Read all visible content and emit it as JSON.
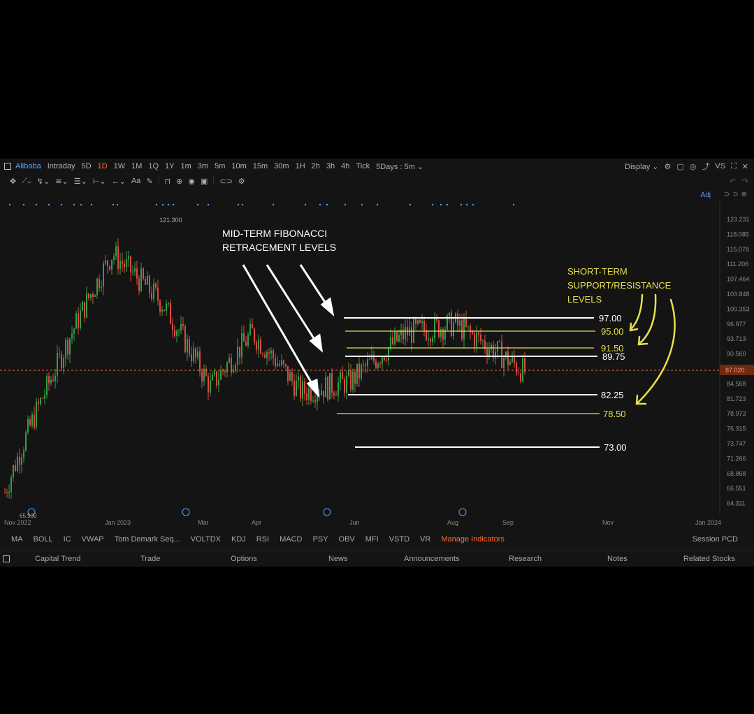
{
  "toolbar": {
    "symbol": "Alibaba",
    "ranges": [
      "Intraday",
      "5D",
      "1D",
      "1W",
      "1M",
      "1Q",
      "1Y",
      "1m",
      "3m",
      "5m",
      "10m",
      "15m",
      "30m",
      "1H",
      "2h",
      "3h",
      "4h",
      "Tick"
    ],
    "active_range": "1D",
    "multi_day": "5Days : 5m",
    "display_label": "Display",
    "right_icons": [
      "gear-icon",
      "window-icon",
      "camera-icon",
      "share-icon",
      "vs-label",
      "fullscreen-icon",
      "close-icon"
    ],
    "vs_label": "VS"
  },
  "adj_label": "Adj",
  "chart": {
    "price_axis_labels": [
      "123.231",
      "118.085",
      "115.078",
      "111.206",
      "107.464",
      "103.848",
      "100.353",
      "96.977",
      "93.713",
      "90.560",
      "87.020",
      "84.568",
      "81.723",
      "78.973",
      "76.315",
      "73.747",
      "71.266",
      "68.868",
      "66.551",
      "64.311"
    ],
    "current_price": "87.020",
    "date_labels": [
      "Nov 2022",
      "Jan 2023",
      "Mar",
      "Apr",
      "Jun",
      "Aug",
      "Sep",
      "Nov",
      "Jan 2024"
    ],
    "high_label": "121.300",
    "low_label": "65.930",
    "annotation_mid": [
      "MID-TERM FIBONACCI",
      "RETRACEMENT LEVELS"
    ],
    "annotation_short": [
      "SHORT-TERM",
      "SUPPORT/RESISTANCE",
      "LEVELS"
    ],
    "levels": [
      {
        "label": "97.00",
        "value": 97.0,
        "color": "#ffffff"
      },
      {
        "label": "95.00",
        "value": 95.0,
        "color": "#e8e04a"
      },
      {
        "label": "91.50",
        "value": 91.5,
        "color": "#e8e04a"
      },
      {
        "label": "89.75",
        "value": 89.75,
        "color": "#ffffff"
      },
      {
        "label": "82.25",
        "value": 82.25,
        "color": "#ffffff"
      },
      {
        "label": "78.50",
        "value": 78.5,
        "color": "#e8e04a"
      },
      {
        "label": "73.00",
        "value": 73.0,
        "color": "#ffffff"
      }
    ]
  },
  "chart_data": {
    "type": "candlestick",
    "title": "Alibaba",
    "xlabel": "",
    "ylabel": "",
    "ylim": [
      64.311,
      123.231
    ],
    "y_scale": "log",
    "x_ticks": [
      "Nov 2022",
      "Jan 2023",
      "Mar",
      "Apr",
      "Jun",
      "Aug",
      "Sep",
      "Nov",
      "Jan 2024"
    ],
    "approx_close_path": [
      {
        "date": "Nov 2022",
        "close": 66
      },
      {
        "date": "Dec 2022",
        "close": 88
      },
      {
        "date": "Jan 2023",
        "close": 114
      },
      {
        "date": "Feb 2023",
        "close": 102
      },
      {
        "date": "Mar 2023",
        "close": 84
      },
      {
        "date": "Apr 2023",
        "close": 95
      },
      {
        "date": "May 2023",
        "close": 83
      },
      {
        "date": "Jun 2023",
        "close": 85
      },
      {
        "date": "Jul 2023",
        "close": 95
      },
      {
        "date": "Aug 2023",
        "close": 97
      },
      {
        "date": "Sep 2023",
        "close": 87
      }
    ],
    "high": 121.3,
    "low": 65.93,
    "last": 87.02,
    "horizontal_levels": [
      97.0,
      95.0,
      91.5,
      89.75,
      82.25,
      78.5,
      73.0
    ]
  },
  "indicators": [
    "MA",
    "BOLL",
    "IC",
    "VWAP",
    "Tom Demark Seq...",
    "VOLTDX",
    "KDJ",
    "RSI",
    "MACD",
    "PSY",
    "OBV",
    "MFI",
    "VSTD",
    "VR"
  ],
  "manage_label": "Manage Indicators",
  "session_label": "Session PCD",
  "nav": [
    "Capital Trend",
    "Trade",
    "Options",
    "News",
    "Announcements",
    "Research",
    "Notes",
    "Related Stocks"
  ],
  "colors": {
    "up": "#2ea043",
    "down": "#e04646",
    "accent": "#ff6a2b",
    "link": "#5aa0ff",
    "fib": "#e8e04a"
  }
}
